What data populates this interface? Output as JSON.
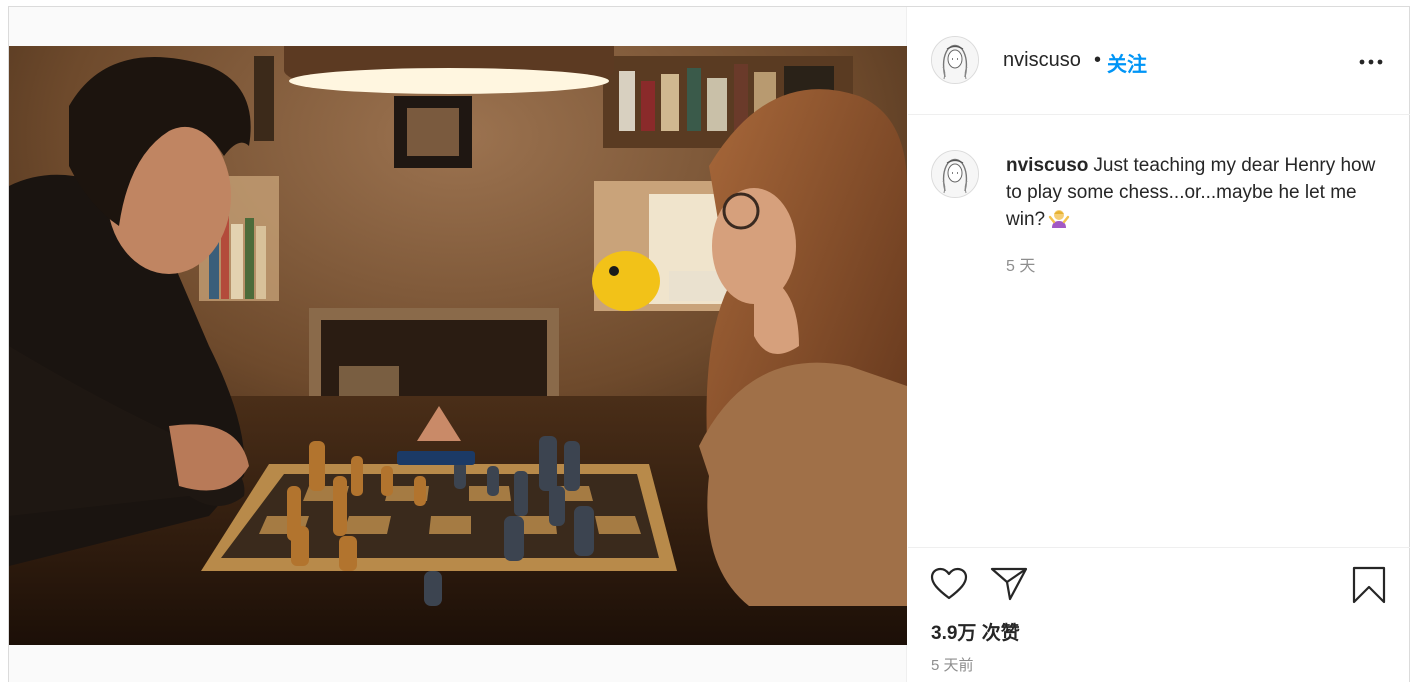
{
  "post": {
    "image_alt": "Two people playing chess at a wooden table in a warm lit room"
  },
  "header": {
    "username": "nviscuso",
    "separator": "•",
    "follow_label": "关注",
    "more_icon": "more-horizontal-icon"
  },
  "caption": {
    "username": "nviscuso",
    "text": "Just teaching my dear Henry how to play some chess...or...maybe he let me win?",
    "emoji": "person-shrugging-emoji",
    "time": "5 天"
  },
  "actions": {
    "like_icon": "heart-outline-icon",
    "share_icon": "paper-plane-icon",
    "save_icon": "bookmark-outline-icon",
    "likes": "3.9万 次赞",
    "time": "5 天前"
  },
  "colors": {
    "link_blue": "#0095f6",
    "text": "#262626",
    "muted": "#8e8e8e",
    "border": "#dbdbdb"
  }
}
